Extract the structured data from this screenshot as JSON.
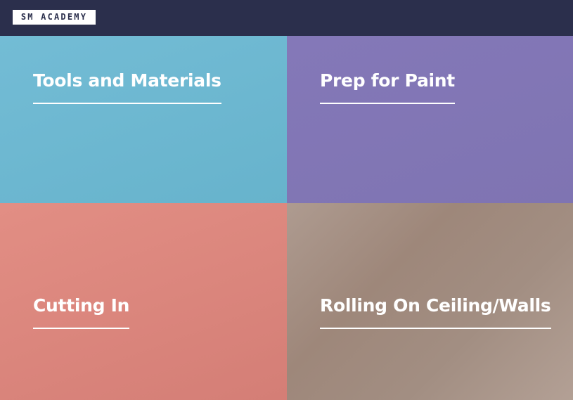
{
  "header": {
    "logo_text": "SM ACADEMY"
  },
  "tiles": [
    {
      "title": "Tools and Materials"
    },
    {
      "title": "Prep for Paint"
    },
    {
      "title": "Cutting In"
    },
    {
      "title": "Rolling On Ceiling/Walls"
    }
  ],
  "colors": {
    "header_bg": "#2b2f4c",
    "tile_blue": "#6fb8d2",
    "tile_purple": "#8277b6",
    "tile_coral": "#dc877e",
    "tile_taupe": "#a6928a"
  }
}
